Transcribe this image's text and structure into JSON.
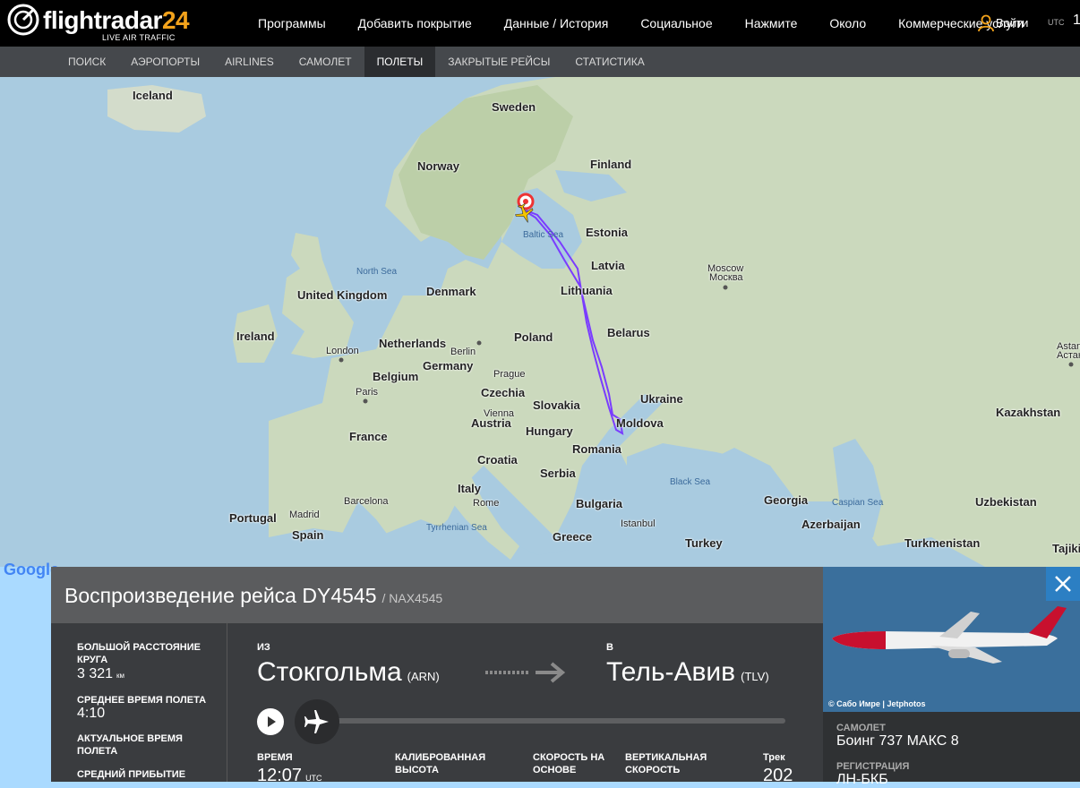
{
  "header": {
    "logo": {
      "name": "flightradar",
      "num": "24",
      "tagline": "LIVE AIR TRAFFIC"
    },
    "nav": [
      "Программы",
      "Добавить покрытие",
      "Данные / История",
      "Социальное",
      "Нажмите",
      "Около",
      "Коммерческие услуги"
    ],
    "login": "Войти",
    "utc": "UTC",
    "clock": "1"
  },
  "subnav": {
    "items": [
      "ПОИСК",
      "АЭРОПОРТЫ",
      "AIRLINES",
      "САМОЛЕТ",
      "ПОЛЕТЫ",
      "ЗАКРЫТЫЕ РЕЙСЫ",
      "СТАТИСТИКА"
    ],
    "active": "ПОЛЕТЫ"
  },
  "map": {
    "countries": [
      "Iceland",
      "Sweden",
      "Norway",
      "Finland",
      "Estonia",
      "Latvia",
      "Lithuania",
      "Denmark",
      "United Kingdom",
      "Ireland",
      "Netherlands",
      "Belgium",
      "Germany",
      "Poland",
      "Belarus",
      "Czechia",
      "Slovakia",
      "Austria",
      "Hungary",
      "Ukraine",
      "Moldova",
      "Romania",
      "France",
      "Croatia",
      "Serbia",
      "Italy",
      "Bulgaria",
      "Georgia",
      "Azerbaijan",
      "Kazakhstan",
      "Uzbekistan",
      "Turkmenistan",
      "Tajiki",
      "Portugal",
      "Spain",
      "Greece",
      "Turkey"
    ],
    "cities": [
      "London",
      "Paris",
      "Berlin",
      "Prague",
      "Vienna",
      "Madrid",
      "Barcelona",
      "Rome",
      "Istanbul",
      "Moscow",
      "Москва",
      "Astan",
      "Астан"
    ],
    "seas": [
      "North Sea",
      "Baltic Sea",
      "Black Sea",
      "Caspian Sea",
      "Tyrrhenian Sea"
    ],
    "attribution": "Google",
    "track_color": "#7a3cff"
  },
  "panel": {
    "title": "Воспроизведение рейса DY4545",
    "callsign": "/ NAX4545",
    "stats_left": [
      {
        "label": "БОЛЬШОЙ РАССТОЯНИЕ КРУГА",
        "value": "3 321",
        "unit": "км"
      },
      {
        "label": "СРЕДНЕЕ ВРЕМЯ ПОЛЕТА",
        "value": "4:10",
        "unit": ""
      },
      {
        "label": "АКТУАЛЬНОЕ ВРЕМЯ ПОЛЕТА",
        "value": "",
        "unit": ""
      },
      {
        "label": "СРЕДНИЙ ПРИБЫТИЕ",
        "value": "",
        "unit": ""
      }
    ],
    "from_label": "ИЗ",
    "from_city": "Стокгольма",
    "from_code": "(ARN)",
    "to_label": "В",
    "to_city": "Тель-Авив",
    "to_code": "(TLV)",
    "playback_progress": 0,
    "stats_bottom": [
      {
        "label": "ВРЕМЯ",
        "value": "12:07",
        "unit": "UTC"
      },
      {
        "label": "КАЛИБРОВАННАЯ ВЫСОТА",
        "value": "",
        "unit": ""
      },
      {
        "label": "СКОРОСТЬ НА ОСНОВЕ",
        "value": "",
        "unit": ""
      },
      {
        "label": "ВЕРТИКАЛЬНАЯ СКОРОСТЬ",
        "value": "",
        "unit": ""
      },
      {
        "label": "Трек",
        "value": "202",
        "unit": ""
      }
    ]
  },
  "side": {
    "photo_credit": "© Сабо Имре | Jetphotos",
    "aircraft_label": "САМОЛЕТ",
    "aircraft": "Боинг 737 МАКС 8",
    "registration_label": "РЕГИСТРАЦИЯ",
    "registration": "ЛН-БКБ"
  }
}
